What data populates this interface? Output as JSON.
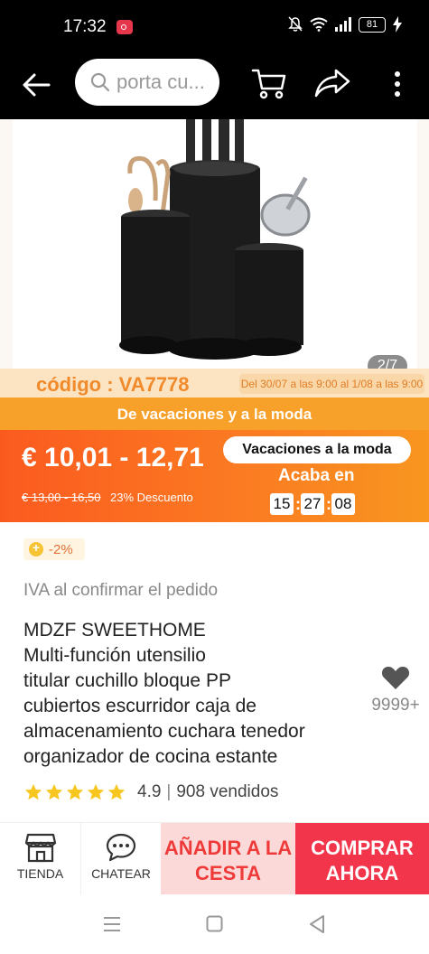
{
  "status_bar": {
    "time": "17:32",
    "battery": "81"
  },
  "top_nav": {
    "search_placeholder": "porta cu..."
  },
  "product_image": {
    "counter": "2/7"
  },
  "promo": {
    "code": "código : VA7778",
    "date_range": "Del 30/07 a las 9:00 al 1/08 a las 9:00",
    "banner": "De vacaciones y a la moda"
  },
  "price": {
    "current": "€ 10,01 - 12,71",
    "original": "€ 13,00 - 16,50",
    "discount": "23% Descuento",
    "campaign": "Vacaciones a la moda",
    "ends_label": "Acaba en",
    "countdown": {
      "hours": "15",
      "minutes": "27",
      "seconds": "08"
    }
  },
  "coin_discount": "-2%",
  "vat_note": "IVA al confirmar el pedido",
  "product": {
    "title_lines": [
      "MDZF SWEETHOME",
      "Multi-función utensilio",
      "titular cuchillo bloque PP",
      "cubiertos escurridor caja de",
      "almacenamiento cuchara tenedor",
      "organizador de cocina estante"
    ],
    "wishlist_count": "9999+",
    "rating": "4.9",
    "sold": "908 vendidos",
    "stars_filled": 5
  },
  "action_bar": {
    "store_label": "TIENDA",
    "chat_label": "CHATEAR",
    "add_to_cart_line1": "AÑADIR A LA",
    "add_to_cart_line2": "CESTA",
    "buy_now_line1": "COMPRAR",
    "buy_now_line2": "AHORA"
  },
  "colors": {
    "accent_orange": "#fb5a1f",
    "promo_orange": "#f7a02a",
    "buy_red": "#f2354b",
    "add_cart_bg": "#fcd9d9",
    "star_yellow": "#f7c61f"
  }
}
